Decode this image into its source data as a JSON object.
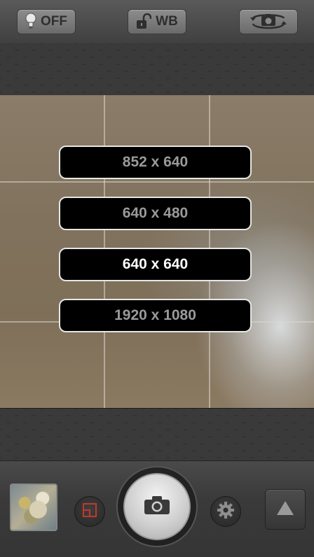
{
  "toolbar": {
    "flash_label": "OFF",
    "wb_label": "WB",
    "flash_icon": "bulb-icon",
    "wb_icon": "unlock-icon",
    "switch_camera_icon": "camera-rotate-icon"
  },
  "resolution_menu": {
    "options": [
      "852 x 640",
      "640 x 480",
      "640 x 640",
      "1920 x 1080"
    ],
    "selected": "640 x 640"
  },
  "bottom_bar": {
    "thumbnail_icon": "gallery-thumbnail",
    "crop_icon": "crop-frame-icon",
    "shutter_icon": "camera-icon",
    "settings_icon": "gear-icon",
    "expand_icon": "triangle-up-icon"
  },
  "colors": {
    "menu_text_selected": "#ffffff",
    "menu_text_normal": "#9a9a9a",
    "crop_icon": "#c0392b"
  }
}
